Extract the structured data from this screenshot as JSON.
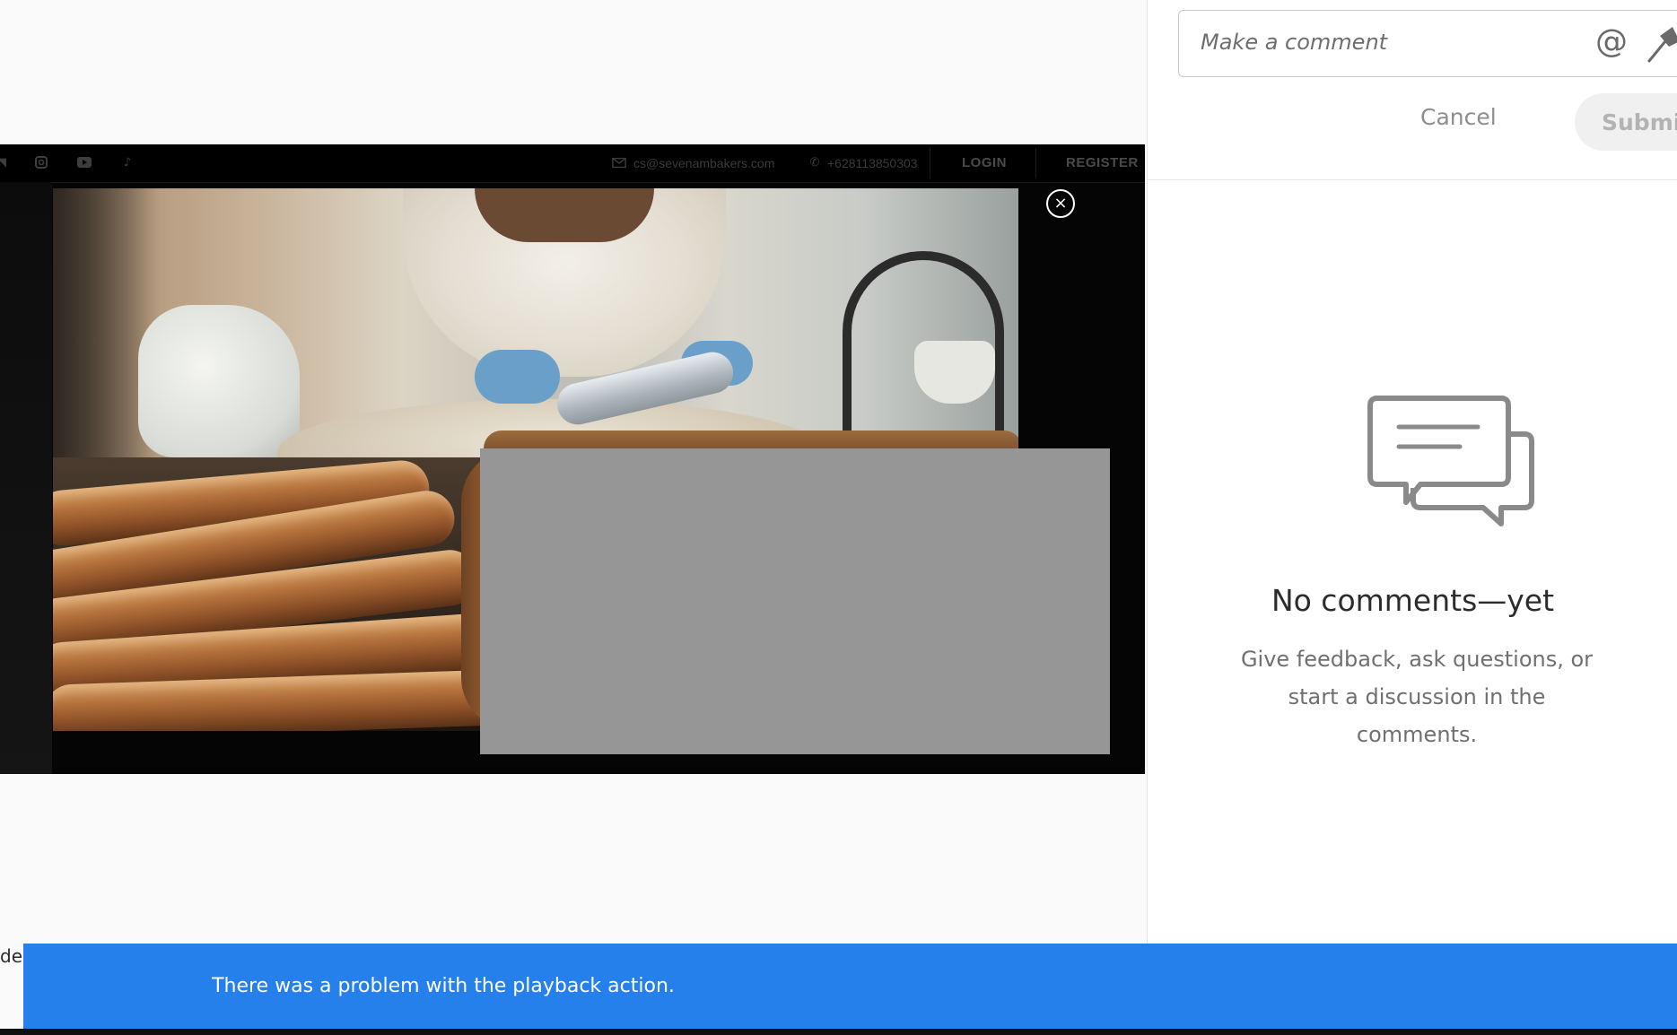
{
  "site_bar": {
    "email": "cs@sevenambakers.com",
    "phone": "+628113850303",
    "login": "LOGIN",
    "register": "REGISTER",
    "social_icons": [
      "twitter-icon",
      "instagram-icon",
      "youtube-icon",
      "tiktok-icon"
    ]
  },
  "video": {
    "close_symbol": "×"
  },
  "comments": {
    "input_placeholder": "Make a comment",
    "mention_symbol": "@",
    "cancel_label": "Cancel",
    "submit_label": "Submit",
    "empty_title": "No comments—yet",
    "empty_description": "Give feedback, ask questions, or start a discussion in the comments."
  },
  "edge_text": "de v",
  "toast": {
    "message": "There was a problem with the playback action."
  },
  "colors": {
    "toast_bg": "#2680eb",
    "placeholder_gray": "#969696",
    "panel_bg": "#ffffff"
  }
}
